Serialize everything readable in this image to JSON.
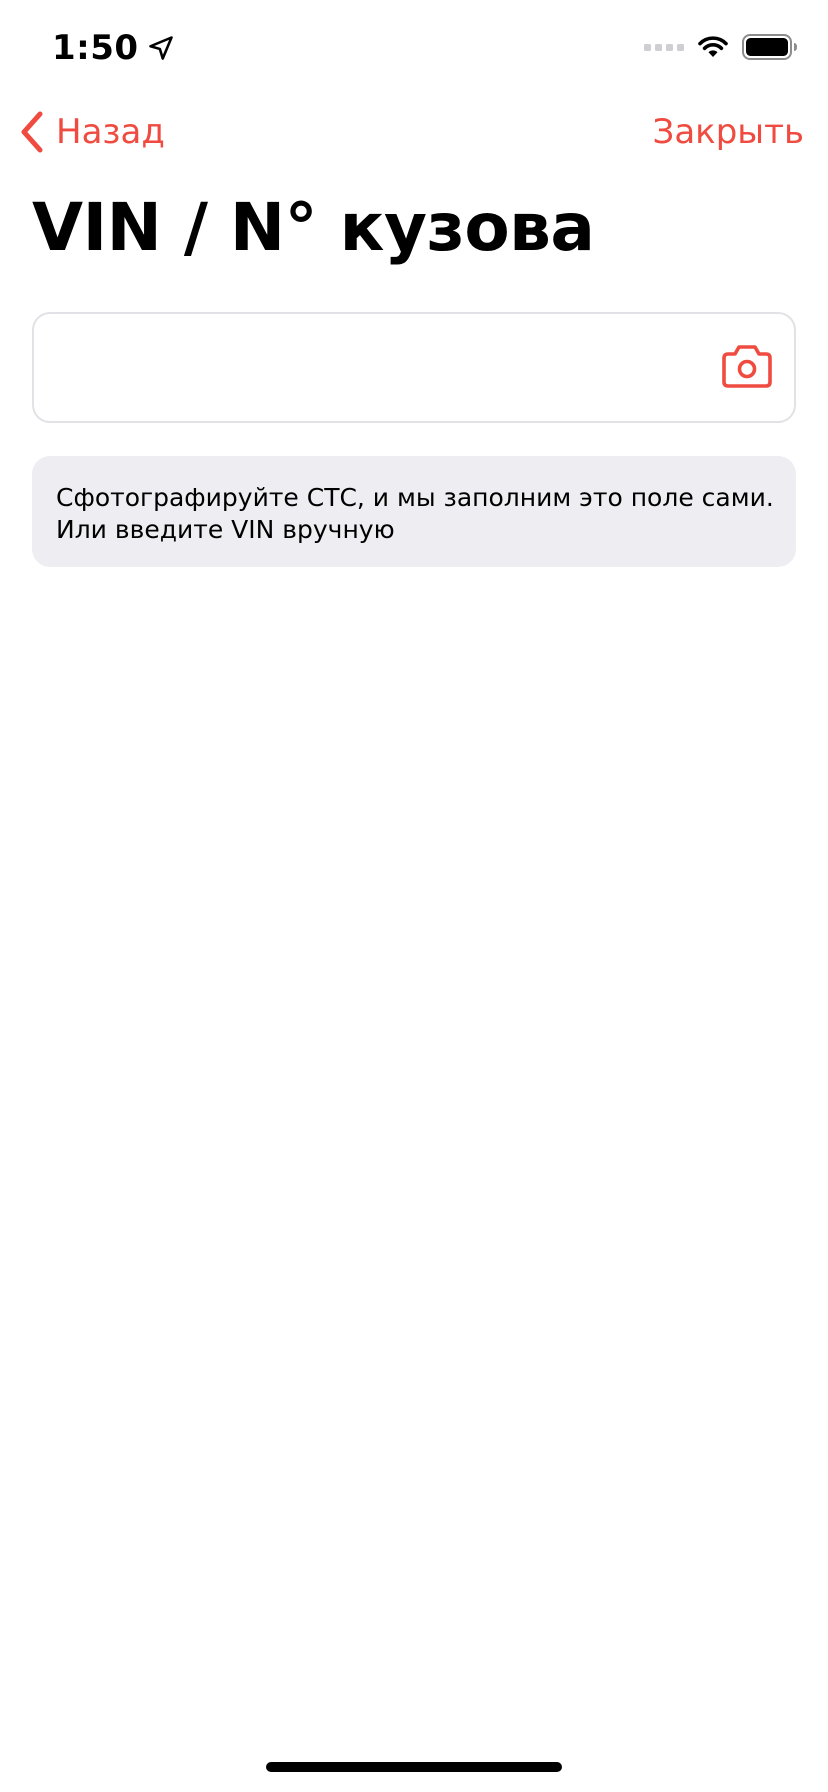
{
  "status_bar": {
    "time": "1:50",
    "icons": [
      "location-arrow-icon",
      "signal-icon",
      "wifi-icon",
      "battery-icon"
    ]
  },
  "nav": {
    "back_label": "Назад",
    "close_label": "Закрыть",
    "accent_color": "#ef4b40"
  },
  "page": {
    "title": "VIN / N° кузова"
  },
  "vin_field": {
    "value": "",
    "placeholder": "",
    "action_icon": "camera-icon"
  },
  "hint": {
    "line1": "Сфотографируйте СТС, и мы заполним это поле сами.",
    "line2": "Или введите VIN вручную"
  }
}
